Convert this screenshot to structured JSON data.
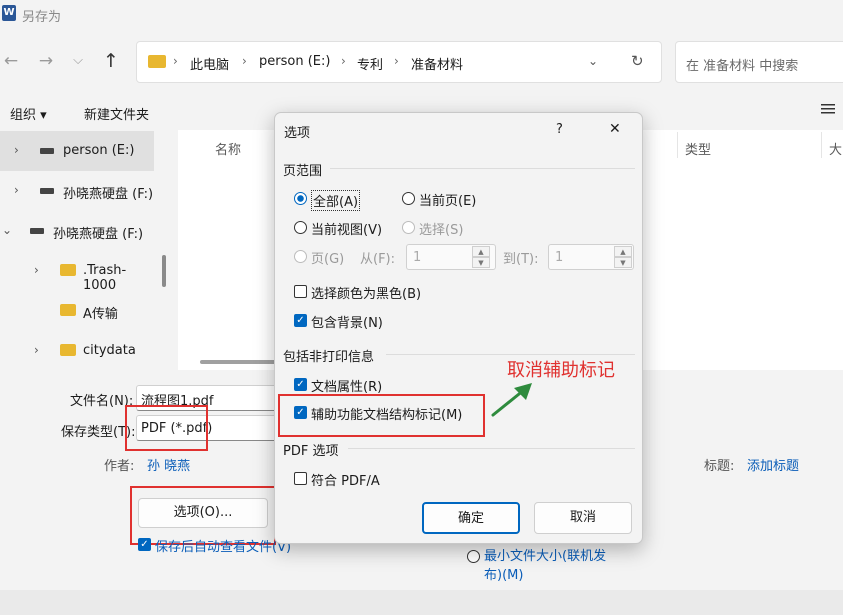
{
  "window": {
    "title": "另存为",
    "app_icon": "word-icon"
  },
  "nav": {
    "back": "←",
    "forward": "→",
    "dropdown": "⌵",
    "up": "↑",
    "refresh": "↻"
  },
  "address": {
    "crumbs": [
      "此电脑",
      "person (E:)",
      "专利",
      "准备材料"
    ],
    "separator": "›"
  },
  "search": {
    "placeholder": "在 准备材料 中搜索"
  },
  "toolbar": {
    "organize": "组织 ▾",
    "new_folder": "新建文件夹"
  },
  "sidebar": {
    "items": [
      {
        "label": "person (E:)",
        "icon": "drive-icon",
        "chevron": "›",
        "selected": true
      },
      {
        "label": "孙晓燕硬盘 (F:)",
        "icon": "drive-icon",
        "chevron": "›"
      },
      {
        "label": "孙晓燕硬盘 (F:)",
        "icon": "drive-icon",
        "chevron": "⌄"
      },
      {
        "label": ".Trash-1000",
        "icon": "folder-icon",
        "chevron": "›"
      },
      {
        "label": "A传输",
        "icon": "folder-icon",
        "chevron": ""
      },
      {
        "label": "citydata",
        "icon": "folder-icon",
        "chevron": "›"
      }
    ]
  },
  "filelist": {
    "columns": [
      "名称",
      "类型",
      "大"
    ]
  },
  "form": {
    "filename_label": "文件名(N):",
    "filename_value": "流程图1.pdf",
    "filetype_label": "保存类型(T):",
    "filetype_value": "PDF (*.pdf)",
    "author_label": "作者:",
    "author_value": "孙 晓燕",
    "tags_label": "标题:",
    "tags_value": "添加标题",
    "options_button": "选项(O)...",
    "open_after": "保存后自动查看文件(V)",
    "min_size": "最小文件大小(联机发布)(M)"
  },
  "dialog": {
    "title": "选项",
    "help": "?",
    "close": "✕",
    "page_range_title": "页范围",
    "all": "全部(A)",
    "current_page": "当前页(E)",
    "current_view": "当前视图(V)",
    "selection": "选择(S)",
    "pages": "页(G)",
    "from": "从(F):",
    "from_value": "1",
    "to": "到(T):",
    "to_value": "1",
    "black": "选择颜色为黑色(B)",
    "background": "包含背景(N)",
    "nonprint_title": "包括非打印信息",
    "doc_props": "文档属性(R)",
    "structure_tags": "辅助功能文档结构标记(M)",
    "pdf_options_title": "PDF 选项",
    "pdfa": "符合 PDF/A",
    "ok": "确定",
    "cancel": "取消"
  },
  "annotation": {
    "text": "取消辅助标记",
    "color": "#e0312f",
    "arrow_color": "#2e8b3d"
  }
}
